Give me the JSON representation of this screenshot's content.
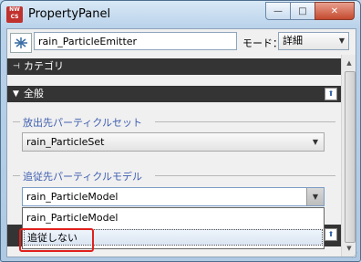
{
  "window": {
    "title": "PropertyPanel",
    "app_icon_text": "NW CS",
    "minimize_glyph": "—",
    "maximize_glyph": "□",
    "close_glyph": "✕"
  },
  "toolbar": {
    "node_icon": "emitter-icon",
    "node_name": "rain_ParticleEmitter",
    "mode_label": "モード：",
    "mode_value": "詳細"
  },
  "sections": {
    "category": {
      "label": "カテゴリ",
      "icon": "pin-icon"
    },
    "general": {
      "label": "全般",
      "icon": "collapse-triangle-icon",
      "pin_glyph": "⬆"
    }
  },
  "fields": {
    "emit_target": {
      "label": "放出先パーティクルセット",
      "value": "rain_ParticleSet"
    },
    "follow_target": {
      "label": "追従先パーティクルモデル",
      "value": "rain_ParticleModel"
    }
  },
  "dropdown": {
    "options": [
      "rain_ParticleModel",
      "追従しない"
    ],
    "selected_index": 1
  },
  "colors": {
    "section_bar": "#343434",
    "group_label": "#3f5fb0",
    "highlight_box": "#e0201c",
    "close_button": "#c44a2f"
  }
}
